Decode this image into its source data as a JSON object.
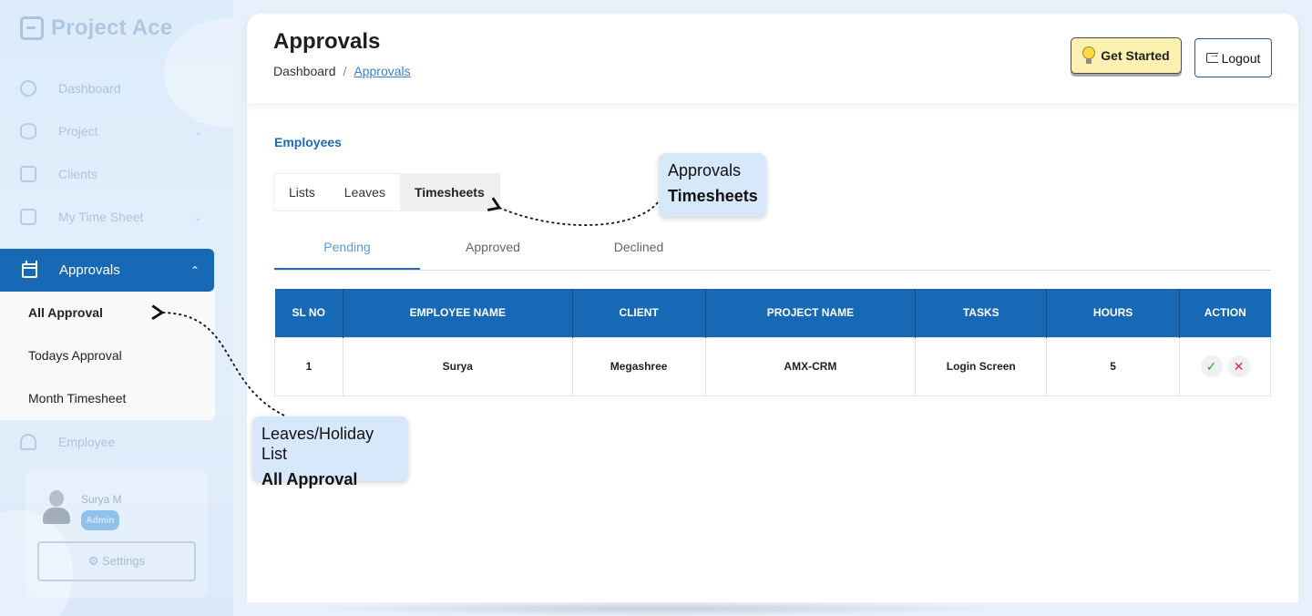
{
  "app": {
    "name": "Project Ace"
  },
  "sidebar": {
    "faded_items": [
      {
        "label": "Dashboard",
        "icon": "dashboard-icon"
      },
      {
        "label": "Project",
        "icon": "project-icon"
      },
      {
        "label": "Clients",
        "icon": "clients-icon"
      },
      {
        "label": "My Time Sheet",
        "icon": "timesheet-icon"
      }
    ],
    "active": {
      "label": "Approvals",
      "icon": "calendar-icon"
    },
    "submenu": [
      "All Approval",
      "Todays Approval",
      "Month Timesheet"
    ],
    "after_items": [
      {
        "label": "Employee",
        "icon": "employee-icon"
      }
    ],
    "profile": {
      "name": "Surya M",
      "role": "Admin"
    },
    "settings_label": "⚙ Settings"
  },
  "header": {
    "title": "Approvals",
    "breadcrumb": {
      "home": "Dashboard",
      "separator": "/",
      "current": "Approvals"
    },
    "get_started": "Get Started",
    "logout": "Logout"
  },
  "section": {
    "label": "Employees"
  },
  "tabs": [
    "Lists",
    "Leaves",
    "Timesheets"
  ],
  "active_tab": "Timesheets",
  "subtabs": [
    "Pending",
    "Approved",
    "Declined"
  ],
  "active_subtab": "Pending",
  "table": {
    "headers": [
      "SL NO",
      "EMPLOYEE NAME",
      "CLIENT",
      "PROJECT NAME",
      "TASKS",
      "HOURS",
      "ACTION"
    ],
    "rows": [
      {
        "sl": "1",
        "employee": "Surya",
        "client": "Megashree",
        "project": "AMX-CRM",
        "task": "Login Screen",
        "hours": "5"
      }
    ]
  },
  "callouts": {
    "top": {
      "line1": "Approvals",
      "line2": "Timesheets"
    },
    "bottom": {
      "line1": "Leaves/Holiday List",
      "line2": "All Approval"
    }
  },
  "colors": {
    "primary": "#1769b5",
    "callout_bg": "#d7e8fb",
    "get_started_bg": "#fdf1b1",
    "approve": "#2aa02a",
    "reject": "#e03030"
  }
}
